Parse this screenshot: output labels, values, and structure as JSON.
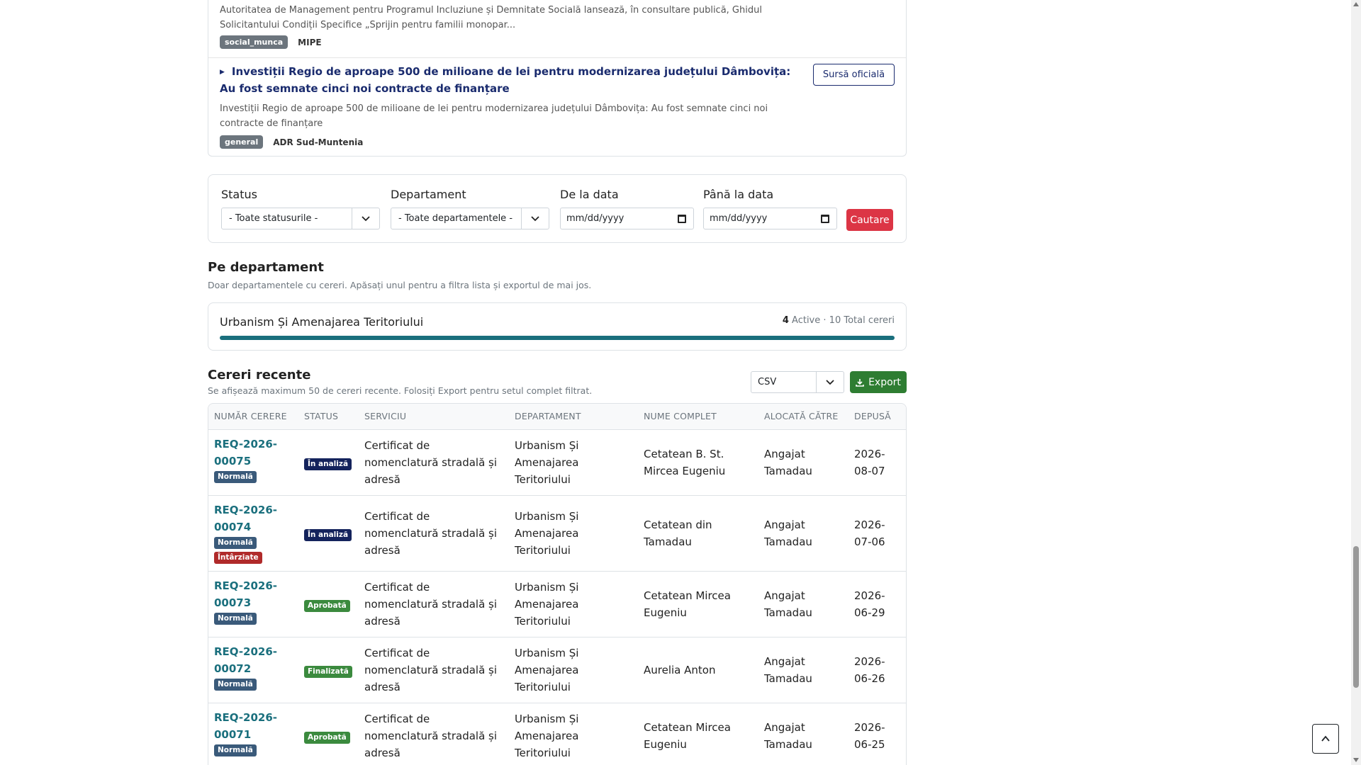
{
  "news": {
    "item1": {
      "description": "Autoritatea de Management pentru Programul Incluziune și Demnitate Socială lansează, în consultare publică, Ghidul Solicitantului Condiții Specifice „Sprijin pentru familii monopar...",
      "tag": "social_munca",
      "source": "MIPE"
    },
    "item2": {
      "title": "Investiții Regio de aproape 500 de milioane de lei pentru modernizarea județului Dâmbovița: Au fost semnate cinci noi contracte de finanțare",
      "description": "Investiții Regio de aproape 500 de milioane de lei pentru modernizarea județului Dâmbovița: Au fost semnate cinci noi contracte de finanțare",
      "tag": "general",
      "source": "ADR Sud-Muntenia",
      "button": "Sursă oficială"
    }
  },
  "filters": {
    "status_label": "Status",
    "status_value": "- Toate statusurile -",
    "department_label": "Departament",
    "department_value": "- Toate departamentele -",
    "from_label": "De la data",
    "from_value": "mm/dd/yyyy",
    "to_label": "Până la data",
    "to_value": "mm/dd/yyyy",
    "search_button": "Cautare"
  },
  "by_department": {
    "title": "Pe departament",
    "subtitle": "Doar departamentele cu cereri. Apăsați unul pentru a filtra lista și exportul de mai jos.",
    "items": [
      {
        "name": "Urbanism Și Amenajarea Teritoriului",
        "active": "4",
        "active_label": "Active",
        "sep": "·",
        "total": "10 Total cereri",
        "bar_fraction": 1.0
      }
    ]
  },
  "recent": {
    "title": "Cereri recente",
    "subtitle": "Se afișează maximum 50 de cereri recente. Folosiți Export pentru setul complet filtrat.",
    "format_value": "CSV",
    "export_button": "Export",
    "columns": [
      "Număr cerere",
      "Status",
      "Serviciu",
      "Departament",
      "Nume complet",
      "Alocată către",
      "Depusă"
    ],
    "rows": [
      {
        "number": "REQ-2026-00075",
        "priority": "Normală",
        "late": "",
        "status": "În analiză",
        "service": "Certificat de nomenclatură stradală și adresă",
        "department": "Urbanism Și Amenajarea Teritoriului",
        "name": "Cetatean B. St. Mircea Eugeniu",
        "assigned": "Angajat Tamadau",
        "submitted": "2026-08-07"
      },
      {
        "number": "REQ-2026-00074",
        "priority": "Normală",
        "late": "Întârziate",
        "status": "În analiză",
        "service": "Certificat de nomenclatură stradală și adresă",
        "department": "Urbanism Și Amenajarea Teritoriului",
        "name": "Cetatean din Tamadau",
        "assigned": "Angajat Tamadau",
        "submitted": "2026-07-06"
      },
      {
        "number": "REQ-2026-00073",
        "priority": "Normală",
        "late": "",
        "status": "Aprobată",
        "service": "Certificat de nomenclatură stradală și adresă",
        "department": "Urbanism Și Amenajarea Teritoriului",
        "name": "Cetatean Mircea Eugeniu",
        "assigned": "Angajat Tamadau",
        "submitted": "2026-06-29"
      },
      {
        "number": "REQ-2026-00072",
        "priority": "Normală",
        "late": "",
        "status": "Finalizată",
        "service": "Certificat de nomenclatură stradală și adresă",
        "department": "Urbanism Și Amenajarea Teritoriului",
        "name": "Aurelia Anton",
        "assigned": "Angajat Tamadau",
        "submitted": "2026-06-26"
      },
      {
        "number": "REQ-2026-00071",
        "priority": "Normală",
        "late": "",
        "status": "Aprobată",
        "service": "Certificat de nomenclatură stradală și adresă",
        "department": "Urbanism Și Amenajarea Teritoriului",
        "name": "Cetatean Mircea Eugeniu",
        "assigned": "Angajat Tamadau",
        "submitted": "2026-06-25"
      }
    ]
  },
  "colors": {
    "accent_teal": "#1a6f7d",
    "danger": "#dc3545",
    "success": "#2e7d32",
    "navy": "#14235c"
  }
}
